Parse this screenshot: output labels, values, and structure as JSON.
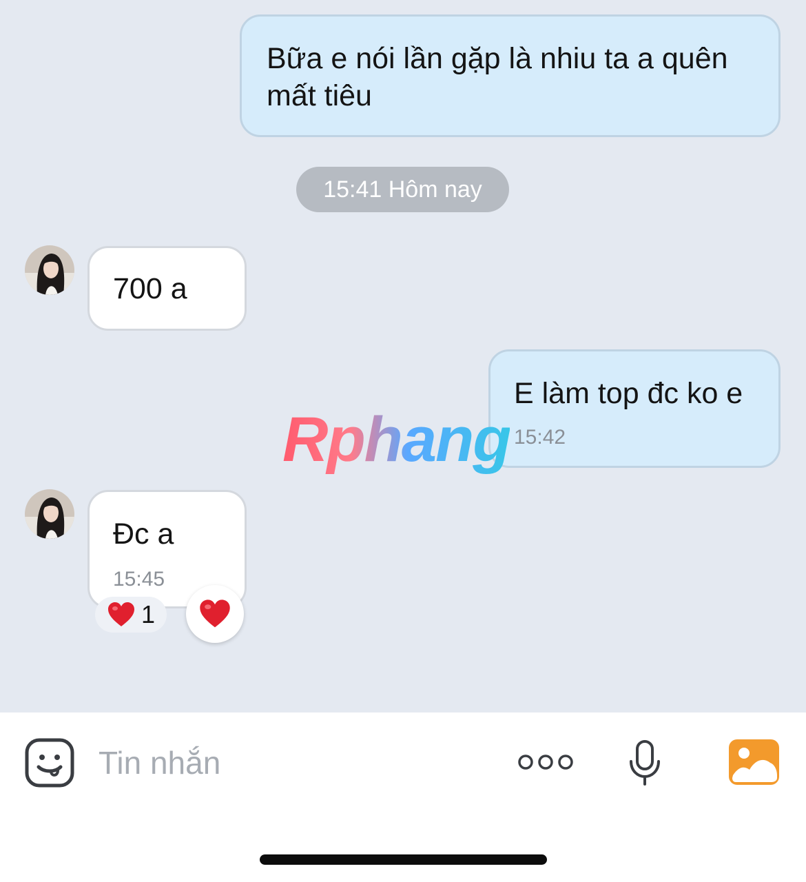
{
  "messages": [
    {
      "id": "m1",
      "direction": "outgoing",
      "text": "Bữa e nói lần gặp là nhiu ta a quên mất tiêu"
    },
    {
      "id": "m2",
      "direction": "incoming",
      "text": "700 a"
    },
    {
      "id": "m3",
      "direction": "outgoing",
      "text": "E làm top đc ko e",
      "time": "15:42"
    },
    {
      "id": "m4",
      "direction": "incoming",
      "text": "Đc a",
      "time": "15:45",
      "reaction": {
        "emoji": "❤️",
        "count": "1"
      }
    }
  ],
  "time_separator": "15:41 Hôm nay",
  "watermark": "Rphang",
  "composer": {
    "placeholder": "Tin nhắn",
    "icons": [
      "sticker-icon",
      "more-icon",
      "microphone-icon",
      "photo-icon"
    ]
  },
  "colors": {
    "background": "#e4e9f1",
    "outgoing_bubble": "#d6ecfb",
    "incoming_bubble": "#ffffff",
    "photo_icon": "#f39a2c",
    "heart": "#e0202e"
  }
}
